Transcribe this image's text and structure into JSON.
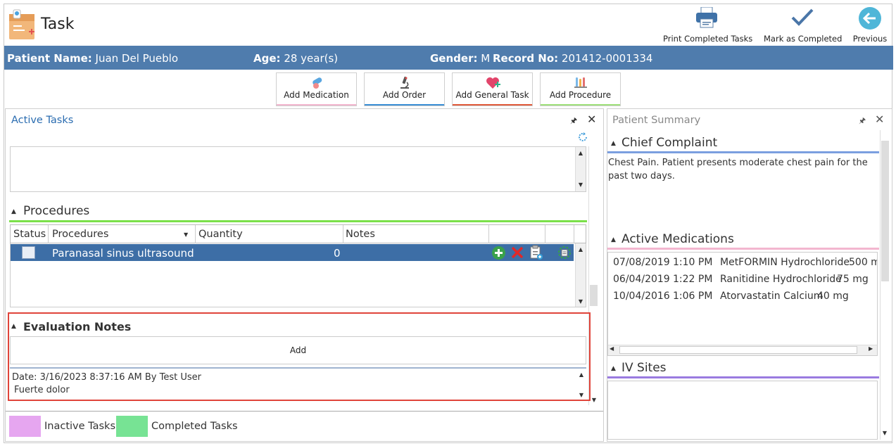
{
  "header": {
    "title": "Task",
    "actions": {
      "print": "Print Completed Tasks",
      "complete": "Mark as Completed",
      "previous": "Previous"
    }
  },
  "patient": {
    "name_label": "Patient Name:",
    "name": "Juan Del Pueblo",
    "age_label": "Age:",
    "age": "28 year(s)",
    "gender_label": "Gender:",
    "gender": "M",
    "record_label": "Record No:",
    "record": "201412-0001334"
  },
  "add_buttons": {
    "medication": "Add Medication",
    "order": "Add Order",
    "general": "Add General Task",
    "procedure": "Add Procedure"
  },
  "active_tasks": {
    "title": "Active Tasks",
    "procedures": {
      "title": "Procedures",
      "columns": [
        "Status",
        "Procedures",
        "Quantity",
        "Notes"
      ],
      "rows": [
        {
          "name": "Paranasal sinus ultrasound",
          "quantity": "0"
        }
      ]
    },
    "evaluation": {
      "title": "Evaluation Notes",
      "add_label": "Add",
      "note_meta": "Date: 3/16/2023 8:37:16 AM By Test User",
      "note_text": "Fuerte dolor"
    }
  },
  "legend": {
    "inactive": "Inactive Tasks",
    "completed": "Completed Tasks"
  },
  "summary": {
    "title": "Patient Summary",
    "chief": {
      "title": "Chief Complaint",
      "text": "Chest Pain. Patient presents moderate chest pain for the past two days."
    },
    "meds": {
      "title": "Active Medications",
      "rows": [
        {
          "date": "07/08/2019",
          "time": "1:10 PM",
          "drug": "MetFORMIN Hydrochloride",
          "dose": "500 m"
        },
        {
          "date": "06/04/2019",
          "time": "1:22 PM",
          "drug": "Ranitidine Hydrochloride",
          "dose": "75 mg"
        },
        {
          "date": "10/04/2016",
          "time": "1:06 PM",
          "drug": "Atorvastatin Calcium",
          "dose": "40 mg"
        }
      ]
    },
    "iv": {
      "title": "IV Sites"
    }
  },
  "colors": {
    "header_bar": "#4f7cad",
    "selected_row": "#3d6ea6",
    "procedures_line": "#7be04a",
    "evaluation_highlight": "#e0443a",
    "chief_line": "#7b9fe0",
    "meds_line": "#f3b6cf",
    "iv_line": "#9a7be0",
    "inactive_swatch": "#e6a6f0",
    "completed_swatch": "#77e394",
    "medication_bar": "#f3b6cf",
    "order_bar": "#3a8fd6",
    "general_bar": "#e05a3a",
    "procedure_bar": "#9fe07a"
  }
}
